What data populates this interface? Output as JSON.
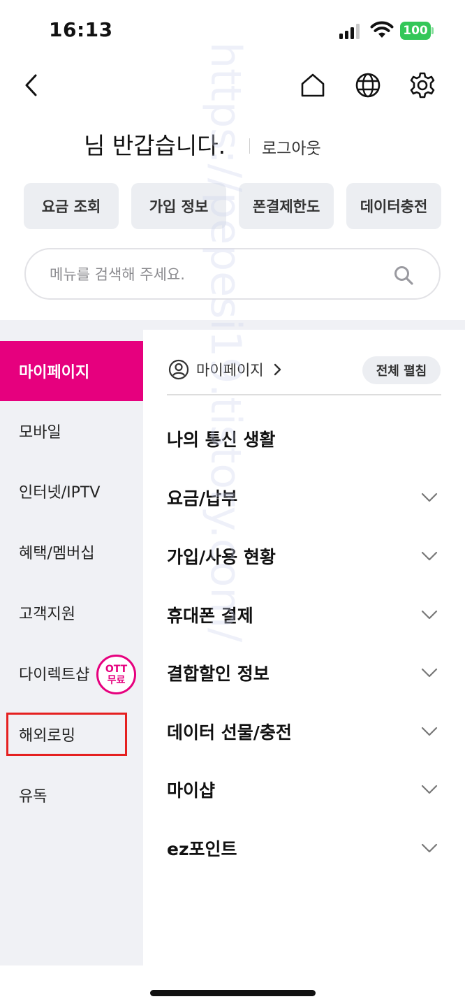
{
  "status_bar": {
    "time": "16:13",
    "battery": "100"
  },
  "greeting": {
    "text": "님 반갑습니다.",
    "logout": "로그아웃"
  },
  "quick_buttons": [
    "요금 조회",
    "가입 정보",
    "폰결제한도",
    "데이터충전"
  ],
  "search": {
    "placeholder": "메뉴를 검색해 주세요."
  },
  "sidebar": {
    "items": [
      {
        "label": "마이페이지",
        "active": true
      },
      {
        "label": "모바일"
      },
      {
        "label": "인터넷/IPTV"
      },
      {
        "label": "혜택/멤버십"
      },
      {
        "label": "고객지원"
      },
      {
        "label": "다이렉트샵",
        "badge": [
          "OTT",
          "무료"
        ]
      },
      {
        "label": "해외로밍",
        "highlighted": true
      },
      {
        "label": "유독"
      }
    ]
  },
  "main": {
    "section_link": "마이페이지",
    "expand_all": "전체 펼침",
    "menus": [
      {
        "title": "나의 통신 생활",
        "expandable": false
      },
      {
        "title": "요금/납부",
        "expandable": true
      },
      {
        "title": "가입/사용 현황",
        "expandable": true
      },
      {
        "title": "휴대폰 결제",
        "expandable": true
      },
      {
        "title": "결합할인 정보",
        "expandable": true
      },
      {
        "title": "데이터 선물/충전",
        "expandable": true
      },
      {
        "title": "마이샵",
        "expandable": true
      },
      {
        "title": "ez포인트",
        "expandable": true
      }
    ]
  },
  "watermark": "https://pepesi19.tistory.com/",
  "colors": {
    "accent": "#e6007e",
    "highlight_border": "#e52020",
    "sidebar_bg": "#f0f1f5",
    "battery": "#34c759"
  },
  "icons": [
    "back-icon",
    "home-icon",
    "globe-icon",
    "settings-icon",
    "search-icon",
    "user-circle-icon",
    "chevron-right-icon",
    "chevron-down-icon"
  ]
}
